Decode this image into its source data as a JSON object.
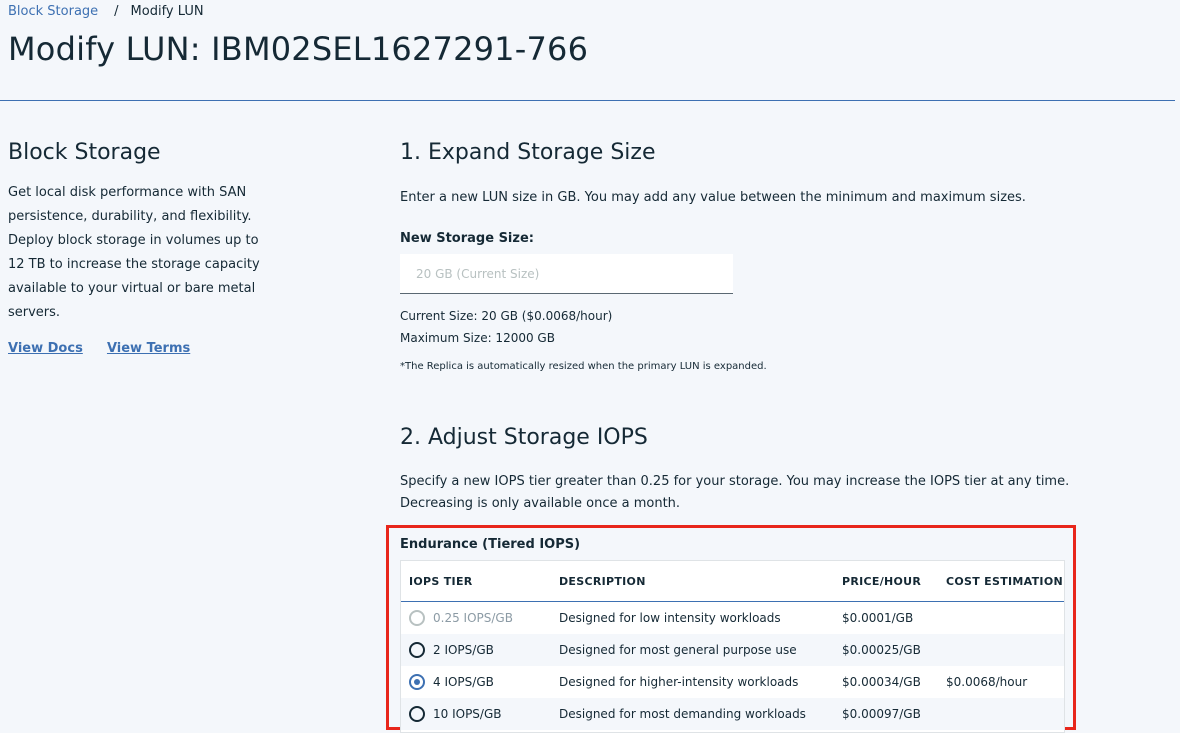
{
  "breadcrumb": {
    "parent": "Block Storage",
    "separator": "/",
    "current": "Modify LUN"
  },
  "page_title": "Modify LUN: IBM02SEL1627291-766",
  "sidebar": {
    "title": "Block Storage",
    "description": "Get local disk performance with SAN persistence, durability, and flexibility. Deploy block storage in volumes up to 12 TB to increase the storage capacity available to your virtual or bare metal servers.",
    "links": {
      "docs": "View Docs",
      "terms": "View Terms"
    }
  },
  "expand": {
    "heading": "1. Expand Storage Size",
    "description": "Enter a new LUN size in GB. You may add any value between the minimum and maximum sizes.",
    "field_label": "New Storage Size:",
    "placeholder": "20 GB (Current Size)",
    "current_size": "Current Size: 20 GB ($0.0068/hour)",
    "maximum_size": "Maximum Size: 12000 GB",
    "note": "*The Replica is automatically resized when the primary LUN is expanded."
  },
  "iops": {
    "heading": "2. Adjust Storage IOPS",
    "description_line1": "Specify a new IOPS tier greater than 0.25 for your storage. You may increase the IOPS tier at any time.",
    "description_line2": "Decreasing is only available once a month.",
    "table_title": "Endurance (Tiered IOPS)",
    "columns": [
      "IOPS TIER",
      "DESCRIPTION",
      "PRICE/HOUR",
      "COST ESTIMATION"
    ],
    "rows": [
      {
        "tier": "0.25 IOPS/GB",
        "description": "Designed for low intensity workloads",
        "price": "$0.0001/GB",
        "cost": "",
        "state": "disabled"
      },
      {
        "tier": "2 IOPS/GB",
        "description": "Designed for most general purpose use",
        "price": "$0.00025/GB",
        "cost": "",
        "state": "unselected"
      },
      {
        "tier": "4 IOPS/GB",
        "description": "Designed for higher-intensity workloads",
        "price": "$0.00034/GB",
        "cost": "$0.0068/hour",
        "state": "selected"
      },
      {
        "tier": "10 IOPS/GB",
        "description": "Designed for most demanding workloads",
        "price": "$0.00097/GB",
        "cost": "",
        "state": "unselected"
      }
    ]
  },
  "colors": {
    "accent": "#3d70b2",
    "highlight_border": "#e8261b",
    "background": "#f4f7fb"
  }
}
